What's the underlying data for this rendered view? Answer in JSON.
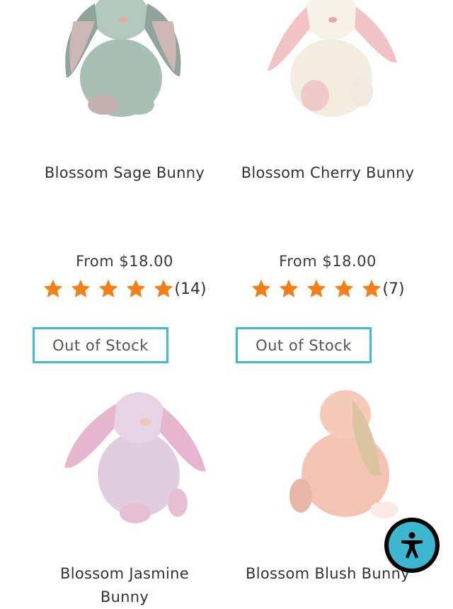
{
  "products": [
    {
      "title": "Blossom Sage Bunny",
      "price": "From $18.00",
      "rating_count": "(14)",
      "rating": 5,
      "stock": "Out of Stock",
      "image_icon": "sage-bunny-plush"
    },
    {
      "title": "Blossom Cherry Bunny",
      "price": "From $18.00",
      "rating_count": "(7)",
      "rating": 5,
      "stock": "Out of Stock",
      "image_icon": "cream-bunny-plush"
    },
    {
      "title_line1": "Blossom Jasmine",
      "title_line2": "Bunny",
      "image_icon": "lilac-bunny-plush"
    },
    {
      "title": "Blossom Blush Bunny",
      "image_icon": "peach-bunny-plush"
    }
  ],
  "colors": {
    "star": "#f57f17",
    "stock_border": "#3fbad4",
    "a11y_bg": "#3bb7cf"
  },
  "accessibility_button_icon": "accessibility-person-icon"
}
